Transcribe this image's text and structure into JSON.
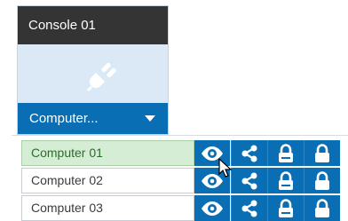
{
  "console": {
    "title": "Console 01",
    "selector_label": "Computer...",
    "icon": "power-plug-icon"
  },
  "computers": [
    {
      "name": "Computer 01",
      "selected": true
    },
    {
      "name": "Computer 02",
      "selected": false
    },
    {
      "name": "Computer 03",
      "selected": false
    }
  ],
  "actions": [
    "eye-icon",
    "share-icon",
    "lock-icon",
    "lock-icon"
  ],
  "colors": {
    "header": "#343434",
    "accent": "#0a6eb5",
    "tile_bg": "#dbe9f6",
    "selected_row": "#d6edd5"
  }
}
